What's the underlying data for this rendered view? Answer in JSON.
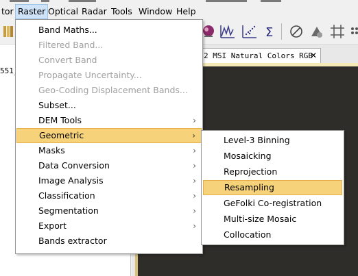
{
  "menubar": {
    "items": [
      {
        "label": "tor"
      },
      {
        "label": "Raster"
      },
      {
        "label": "Optical"
      },
      {
        "label": "Radar"
      },
      {
        "label": "Tools"
      },
      {
        "label": "Window"
      },
      {
        "label": "Help"
      }
    ]
  },
  "toolbar": {
    "icons": [
      "folder-icon",
      "spectrum-icon",
      "graph-icon",
      "scatter-icon",
      "sum-icon",
      "no-entry-icon",
      "pin-icon",
      "grid-icon",
      "dots-icon"
    ]
  },
  "left_panel": {
    "text": "551_"
  },
  "document_tab": {
    "title": "2 MSI Natural Colors RGB",
    "close_label": "✕"
  },
  "raster_menu": {
    "items": [
      {
        "label": "Band Maths...",
        "disabled": false,
        "submenu": false
      },
      {
        "label": "Filtered Band...",
        "disabled": true,
        "submenu": false
      },
      {
        "label": "Convert Band",
        "disabled": true,
        "submenu": false
      },
      {
        "label": "Propagate Uncertainty...",
        "disabled": true,
        "submenu": false
      },
      {
        "label": "Geo-Coding Displacement Bands...",
        "disabled": true,
        "submenu": false
      },
      {
        "label": "Subset...",
        "disabled": false,
        "submenu": false
      },
      {
        "label": "DEM Tools",
        "disabled": false,
        "submenu": true
      },
      {
        "label": "Geometric",
        "disabled": false,
        "submenu": true,
        "highlighted": true
      },
      {
        "label": "Masks",
        "disabled": false,
        "submenu": true
      },
      {
        "label": "Data Conversion",
        "disabled": false,
        "submenu": true
      },
      {
        "label": "Image Analysis",
        "disabled": false,
        "submenu": true
      },
      {
        "label": "Classification",
        "disabled": false,
        "submenu": true
      },
      {
        "label": "Segmentation",
        "disabled": false,
        "submenu": true
      },
      {
        "label": "Export",
        "disabled": false,
        "submenu": true
      },
      {
        "label": "Bands extractor",
        "disabled": false,
        "submenu": false
      }
    ],
    "arrow": "›"
  },
  "geometric_submenu": {
    "items": [
      {
        "label": "Level-3 Binning"
      },
      {
        "label": "Mosaicking"
      },
      {
        "label": "Reprojection"
      },
      {
        "label": "Resampling",
        "highlighted": true
      },
      {
        "label": "GeFolki Co-registration"
      },
      {
        "label": "Multi-size Mosaic"
      },
      {
        "label": "Collocation"
      }
    ]
  },
  "colors": {
    "menu_highlight": "#f6d27a",
    "menubar_active": "#cfe3f8",
    "disabled_text": "#a0a0a0",
    "canvas_bg": "#2f2d2a"
  }
}
